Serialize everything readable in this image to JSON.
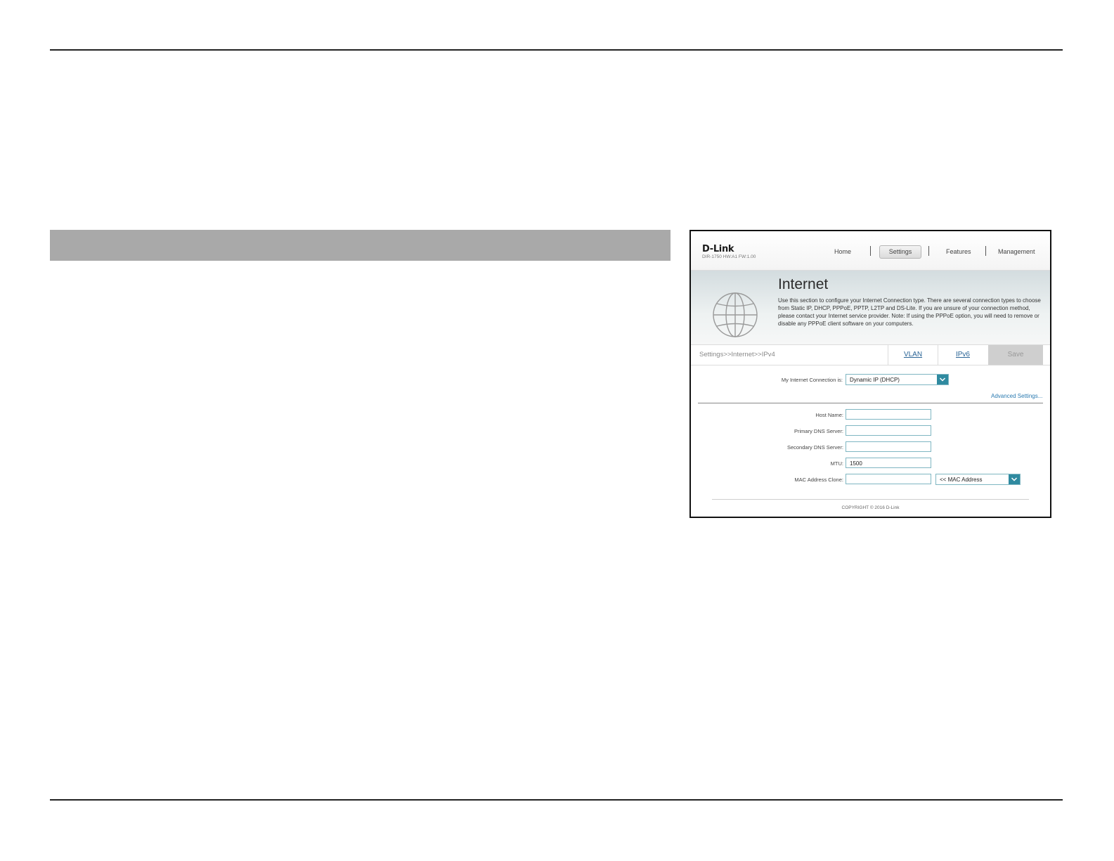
{
  "router_ui": {
    "logo": "D-Link",
    "model": "DIR-1750 HW:A1 FW:1.00",
    "nav": [
      "Home",
      "Settings",
      "Features",
      "Management"
    ],
    "active_nav": "Settings",
    "page_title": "Internet",
    "description": "Use this section to configure your Internet Connection type. There are several connection types to choose from Static IP, DHCP, PPPoE, PPTP, L2TP and DS-Lite. If you are unsure of your connection method, please contact your Internet service provider. Note: If using the PPPoE option, you will need to remove or disable any PPPoE client software on your computers.",
    "breadcrumb": "Settings>>Internet>>IPv4",
    "tab_vlan": "VLAN",
    "tab_ipv6": "IPv6",
    "save_label": "Save",
    "connection_label": "My Internet Connection is:",
    "connection_value": "Dynamic IP (DHCP)",
    "advanced_link": "Advanced Settings...",
    "fields": {
      "host_name_label": "Host Name:",
      "host_name_value": "",
      "primary_dns_label": "Primary DNS Server:",
      "primary_dns_value": "",
      "secondary_dns_label": "Secondary DNS Server:",
      "secondary_dns_value": "",
      "mtu_label": "MTU:",
      "mtu_value": "1500",
      "mac_clone_label": "MAC Address Clone:",
      "mac_clone_value": "",
      "mac_select_value": "<< MAC Address"
    },
    "copyright": "COPYRIGHT © 2016 D-Link",
    "colors": {
      "accent": "#2f8aa0",
      "link": "#2a7ab0",
      "section_bar": "#a9a9a9"
    },
    "icons": [
      "globe-icon",
      "chevron-down-icon"
    ]
  }
}
